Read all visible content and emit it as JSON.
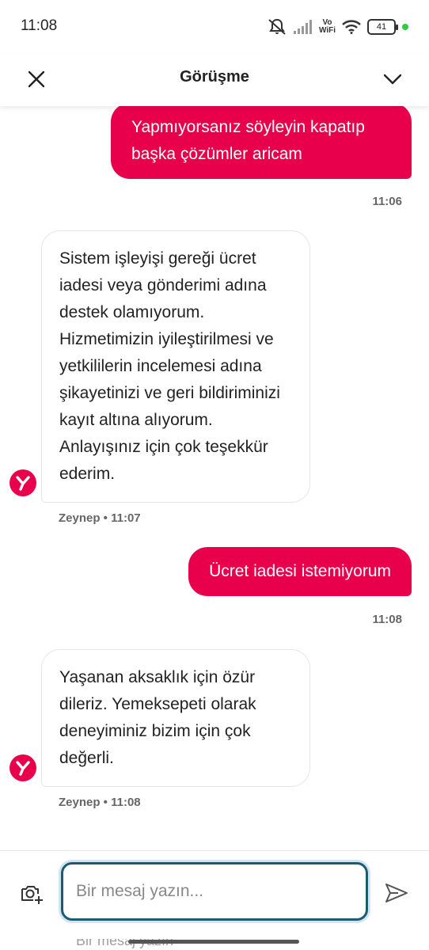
{
  "status_bar": {
    "time": "11:08",
    "vowifi_top": "Vo",
    "vowifi_bottom": "WiFi",
    "battery": "41"
  },
  "header": {
    "title": "Görüşme",
    "close_icon": "close-icon",
    "chevron_icon": "chevron-down-icon"
  },
  "messages": [
    {
      "direction": "outgoing",
      "text": "Yapmıyorsanız söyleyin kapatıp başka çözümler aricam",
      "time": "11:06"
    },
    {
      "direction": "incoming",
      "text": "Sistem işleyişi gereği ücret iadesi veya gönderimi adına destek olamıyorum. Hizmetimizin iyileştirilmesi ve yetkililerin incelemesi adına şikayetinizi ve geri bildiriminizi kayıt altına alıyorum. Anlayışınız için çok teşekkür ederim.",
      "meta": "Zeynep • 11:07"
    },
    {
      "direction": "outgoing",
      "text": "Ücret iadesi istemiyorum",
      "time": "11:08"
    },
    {
      "direction": "incoming",
      "text": "Yaşanan aksaklık için özür dileriz. Yemeksepeti olarak deneyiminiz bizim için çok değerli.",
      "meta": "Zeynep • 11:08"
    }
  ],
  "composer": {
    "placeholder": "Bir mesaj yazın...",
    "value": "",
    "camera_icon": "camera-add-icon",
    "send_icon": "send-icon"
  },
  "ghost_text": "Bir mesaj yazın",
  "colors": {
    "brand": "#e8004c",
    "input_border": "#1f5a73"
  }
}
